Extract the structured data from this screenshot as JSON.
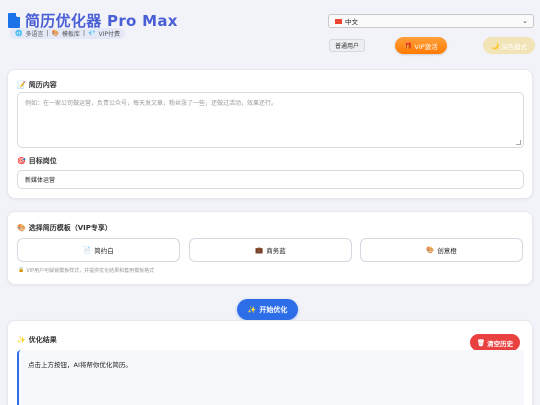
{
  "header": {
    "app_title": "简历优化器 Pro Max",
    "tag_multilang": "多语言",
    "tag_template": "模板库",
    "tag_vip": "VIP付费",
    "language": "中文",
    "user_badge": "普通用户",
    "vip_button": "VIP激活",
    "dark_mode_button": "深色模式"
  },
  "resume": {
    "label": "简历内容",
    "placeholder": "例如：在一家公司做运营，负责公众号，每天发文章，粉丝涨了一些，还做过活动，效果还行。",
    "target_label": "目标岗位",
    "target_value": "新媒体运营"
  },
  "templates": {
    "label": "选择简历模板（VIP专享）",
    "items": [
      {
        "name": "简约白",
        "icon": "document-icon"
      },
      {
        "name": "商务蓝",
        "icon": "briefcase-icon"
      },
      {
        "name": "创意橙",
        "icon": "palette-icon"
      }
    ],
    "hint": "VIP用户可解锁模板样式，并提供优化结果和套用模板格式"
  },
  "actions": {
    "start_button": "开始优化"
  },
  "result": {
    "label": "优化结果",
    "clear_button": "清空历史",
    "text": "点击上方按钮，AI将帮你优化简历。"
  },
  "colors": {
    "brand": "#4a5fd6",
    "primary": "#2d6ee8",
    "vip": "#ff8a1a",
    "danger": "#e8413f"
  }
}
